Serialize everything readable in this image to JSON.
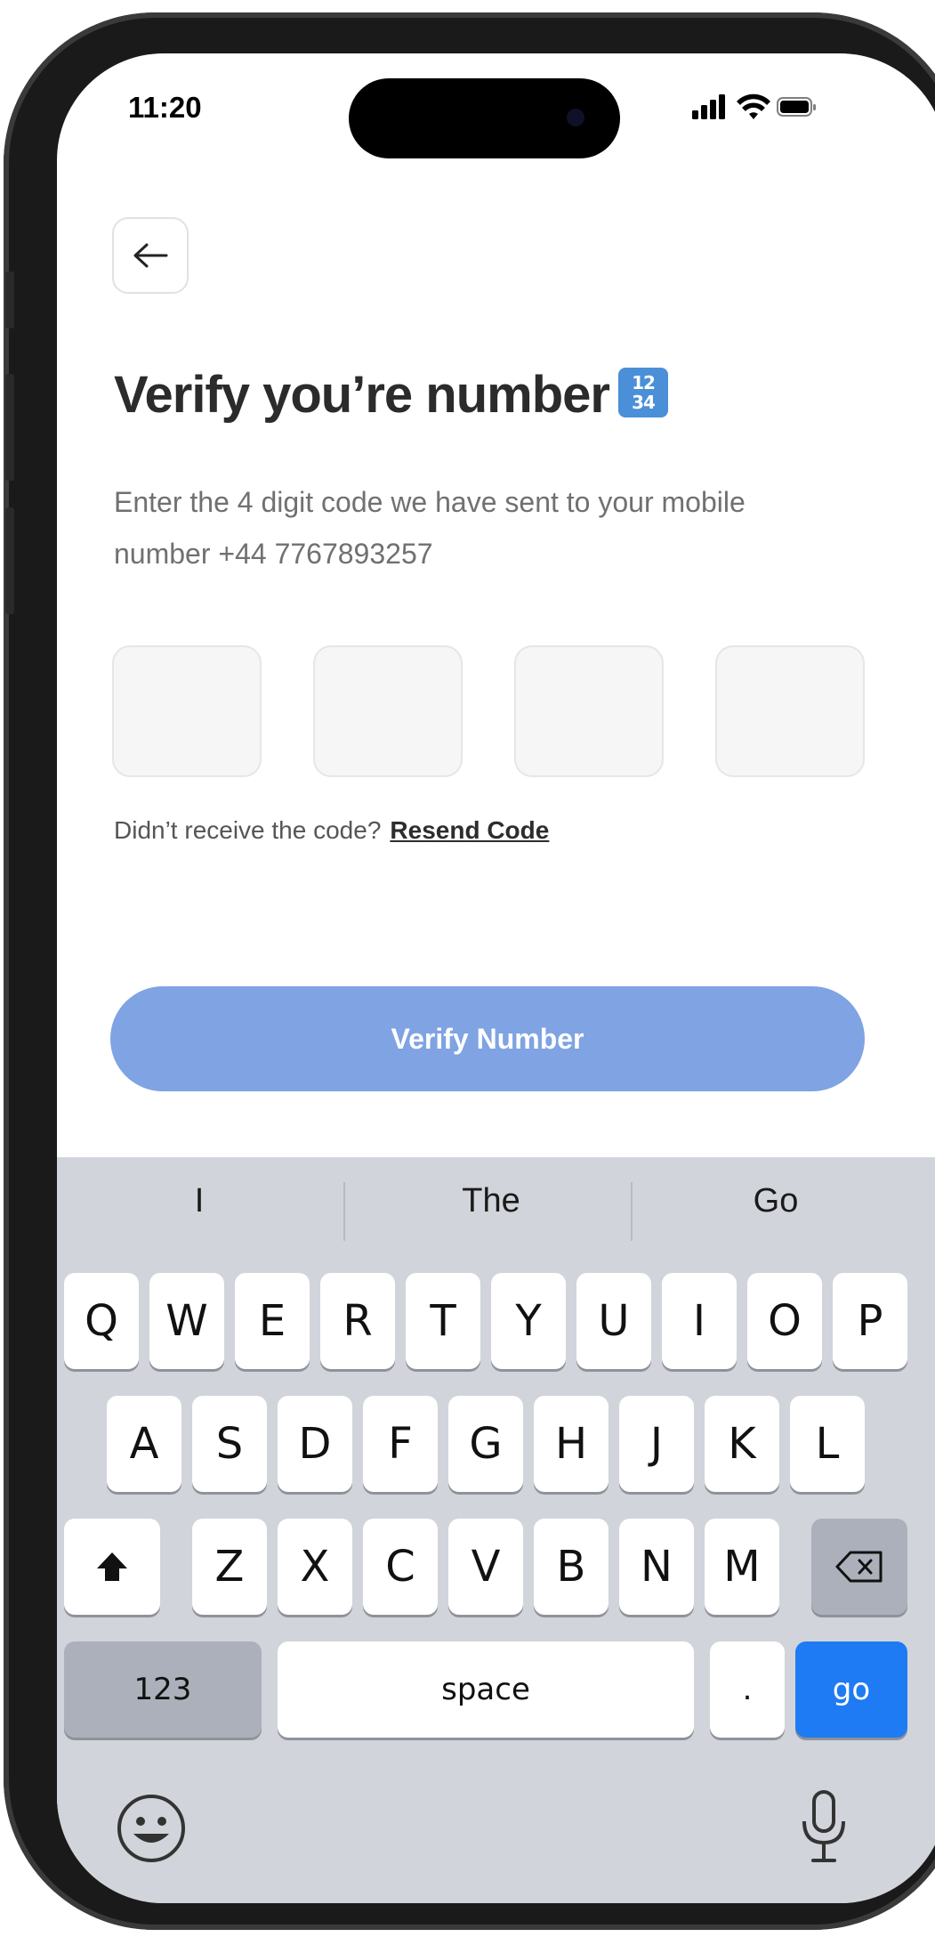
{
  "status_bar": {
    "time": "11:20"
  },
  "header": {
    "back_icon": "arrow-left-icon",
    "title": "Verify you’re number",
    "title_icon": "input-numbers-emoji",
    "title_icon_digits": [
      "12",
      "34"
    ]
  },
  "subtitle": "Enter the 4 digit code we have sent  to your mobile number +44 7767893257",
  "otp": {
    "digits": [
      "",
      "",
      "",
      ""
    ]
  },
  "resend": {
    "prompt": "Didn’t receive the code?",
    "link": "Resend Code"
  },
  "verify_button": {
    "label": "Verify Number",
    "color": "#7fa3e3"
  },
  "keyboard": {
    "suggestions": [
      "I",
      "The",
      "Go"
    ],
    "row1": [
      "Q",
      "W",
      "E",
      "R",
      "T",
      "Y",
      "U",
      "I",
      "O",
      "P"
    ],
    "row2": [
      "A",
      "S",
      "D",
      "F",
      "G",
      "H",
      "J",
      "K",
      "L"
    ],
    "row3": [
      "Z",
      "X",
      "C",
      "V",
      "B",
      "N",
      "M"
    ],
    "shift_icon": "shift-icon",
    "delete_icon": "delete-icon",
    "numbers_label": "123",
    "space_label": "space",
    "period_label": ".",
    "go_label": "go",
    "emoji_icon": "emoji-icon",
    "mic_icon": "microphone-icon",
    "go_color": "#1f7bf3"
  }
}
